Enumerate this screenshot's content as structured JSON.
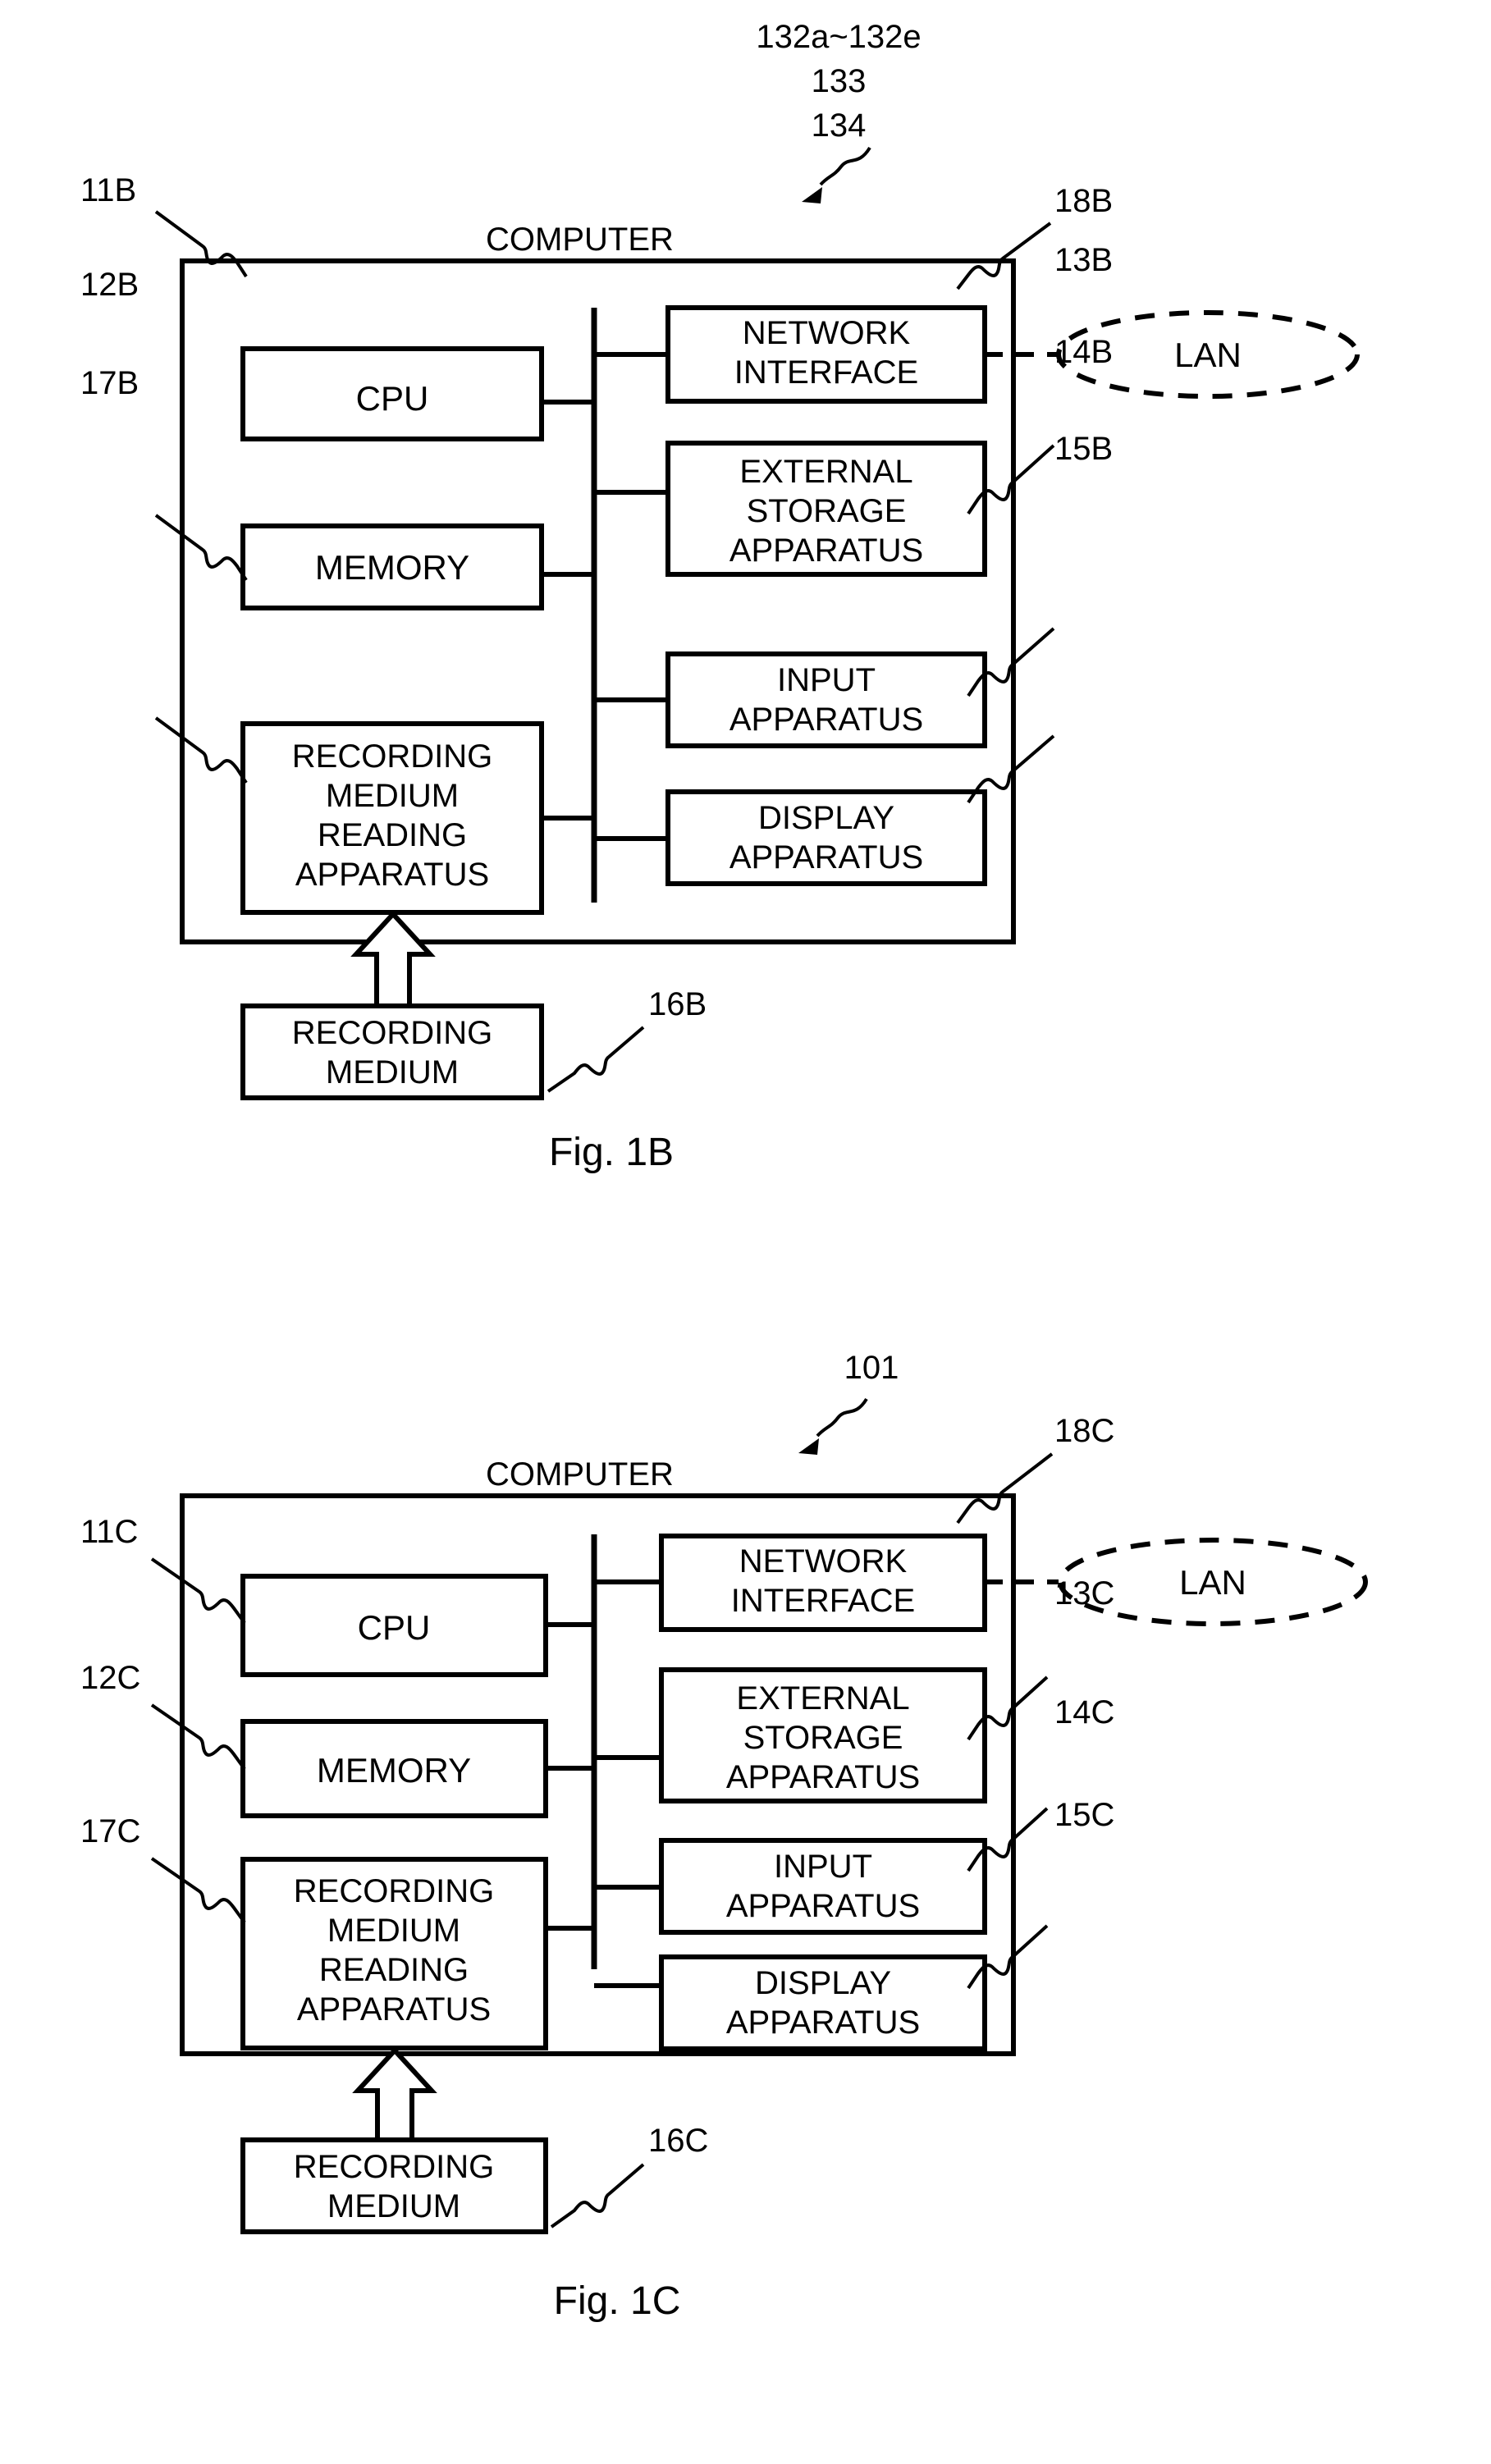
{
  "document": {
    "type": "patent-figure-sheet",
    "figures": [
      {
        "id": "fig-1b",
        "caption": "Fig. 1B",
        "enclosure_label": "COMPUTER",
        "callouts_top": [
          "132a~132e",
          "133",
          "134"
        ],
        "left_blocks": [
          {
            "ref": "11B",
            "label": "CPU"
          },
          {
            "ref": "12B",
            "label": "MEMORY"
          },
          {
            "ref": "17B",
            "label": "RECORDING MEDIUM READING APPARATUS"
          }
        ],
        "right_blocks": [
          {
            "ref": "18B",
            "label": "NETWORK INTERFACE"
          },
          {
            "ref": "13B",
            "label": "EXTERNAL STORAGE APPARATUS"
          },
          {
            "ref": "14B",
            "label": "INPUT APPARATUS"
          },
          {
            "ref": "15B",
            "label": "DISPLAY APPARATUS"
          }
        ],
        "external_blocks": [
          {
            "ref": "16B",
            "label": "RECORDING MEDIUM"
          }
        ],
        "network_node": {
          "label": "LAN",
          "style": "dashed-ellipse"
        }
      },
      {
        "id": "fig-1c",
        "caption": "Fig. 1C",
        "enclosure_label": "COMPUTER",
        "callouts_top": [
          "101"
        ],
        "left_blocks": [
          {
            "ref": "11C",
            "label": "CPU"
          },
          {
            "ref": "12C",
            "label": "MEMORY"
          },
          {
            "ref": "17C",
            "label": "RECORDING MEDIUM READING APPARATUS"
          }
        ],
        "right_blocks": [
          {
            "ref": "18C",
            "label": "NETWORK INTERFACE"
          },
          {
            "ref": "13C",
            "label": "EXTERNAL STORAGE APPARATUS"
          },
          {
            "ref": "14C",
            "label": "INPUT APPARATUS"
          },
          {
            "ref": "15C",
            "label": "DISPLAY APPARATUS"
          }
        ],
        "external_blocks": [
          {
            "ref": "16C",
            "label": "RECORDING MEDIUM"
          }
        ],
        "network_node": {
          "label": "LAN",
          "style": "dashed-ellipse"
        }
      }
    ],
    "colors": {
      "ink": "#000000",
      "paper": "#ffffff"
    }
  }
}
